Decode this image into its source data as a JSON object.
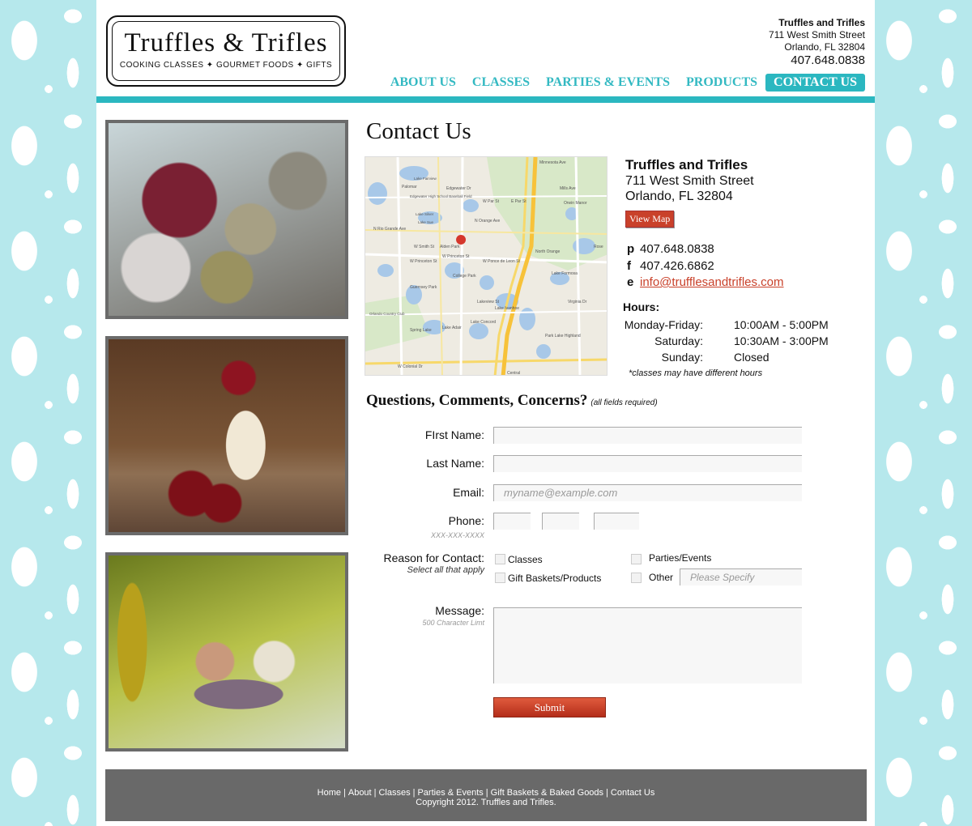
{
  "logo": {
    "title": "Truffles & Trifles",
    "subtitle": "COOKING CLASSES ✦ GOURMET FOODS ✦ GIFTS"
  },
  "header": {
    "name": "Truffles and Trifles",
    "street": "711 West Smith Street",
    "city": "Orlando, FL 32804",
    "phone": "407.648.0838"
  },
  "nav": {
    "items": [
      "ABOUT US",
      "CLASSES",
      "PARTIES & EVENTS",
      "PRODUCTS",
      "CONTACT US"
    ],
    "active": "CONTACT US"
  },
  "page": {
    "title": "Contact Us"
  },
  "business": {
    "name": "Truffles and Trifles",
    "street": "711 West Smith Street",
    "city": "Orlando, FL 32804",
    "view_map": "View Map"
  },
  "contact": {
    "p_key": "p",
    "phone": "407.648.0838",
    "f_key": "f",
    "fax": "407.426.6862",
    "e_key": "e",
    "email": "info@trufflesandtrifles.com"
  },
  "hours": {
    "heading": "Hours:",
    "rows": [
      {
        "day": "Monday-Friday:",
        "time": "10:00AM - 5:00PM"
      },
      {
        "day": "Saturday:",
        "time": "10:30AM - 3:00PM"
      },
      {
        "day": "Sunday:",
        "time": "Closed"
      }
    ],
    "note": "*classes may have different hours"
  },
  "form": {
    "heading": "Questions, Comments, Concerns?",
    "heading_note": "(all fields required)",
    "first_name_label": "FIrst Name:",
    "last_name_label": "Last Name:",
    "email_label": "Email:",
    "email_placeholder": "myname@example.com",
    "phone_label": "Phone:",
    "phone_hint": "XXX-XXX-XXXX",
    "reason_label": "Reason for Contact:",
    "reason_hint": "Select all that apply",
    "reasons": [
      "Classes",
      "Parties/Events",
      "Gift Baskets/Products",
      "Other"
    ],
    "other_placeholder": "Please Specify",
    "message_label": "Message:",
    "message_hint": "500 Character Limt",
    "submit": "Submit"
  },
  "map_labels": [
    "Minnesota Ave",
    "Palomar",
    "Lake Fairview",
    "Edgewater High School Baseball Field",
    "W Par St",
    "E Par St",
    "Orwin Manor",
    "Lake Silver",
    "Lake Sue",
    "W Smith St",
    "Alden Park",
    "W Princeton St",
    "W Princeton St",
    "North Orange",
    "W Ponce de Leon St",
    "College Park",
    "Lakeview St",
    "Lake Formosa",
    "Guernsey Park",
    "Lake Ivanhoe",
    "Orlando Country Club",
    "Spring Lake",
    "Lake Adair",
    "Lake Concord",
    "Park Lake Highland",
    "Virginia Dr",
    "Rose",
    "W Colonial Dr",
    "Central",
    "N Orange Ave",
    "Edgewater Dr",
    "Mills Ave",
    "N Rio Grande Ave"
  ],
  "footer": {
    "links": [
      "Home",
      "About",
      "Classes",
      "Parties & Events",
      "Gift Baskets & Baked Goods",
      "Contact Us"
    ],
    "copyright": "Copyright 2012. Truffles and Trifles."
  }
}
